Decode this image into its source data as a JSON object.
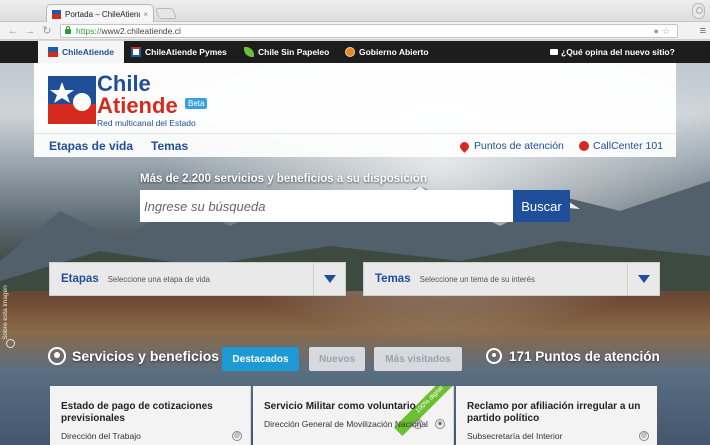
{
  "browser": {
    "tab_title": "Portada – ChileAtiende",
    "tab_close": "×",
    "url_scheme": "https://",
    "url_rest": "www2.chileatiende.cl"
  },
  "topnav": {
    "items": [
      {
        "label": "ChileAtiende",
        "icon": "chileatiende-icon"
      },
      {
        "label": "ChileAtiende Pymes",
        "icon": "pymes-icon"
      },
      {
        "label": "Chile Sin Papeleo",
        "icon": "leaf-icon"
      },
      {
        "label": "Gobierno Abierto",
        "icon": "globe-icon"
      }
    ],
    "feedback": "¿Qué opina del nuevo sitio?"
  },
  "logo": {
    "line1": "Chile",
    "line2": "Atiende",
    "badge": "Beta",
    "subtitle": "Red multicanal del Estado"
  },
  "subnav": {
    "etapas": "Etapas de vida",
    "temas": "Temas",
    "puntos": "Puntos de atención",
    "callcenter": "CallCenter 101"
  },
  "search": {
    "title": "Más de 2.200 servicios y beneficios a su disposición",
    "placeholder": "Ingrese su búsqueda",
    "button": "Buscar"
  },
  "selectors": {
    "etapas_label": "Etapas",
    "etapas_placeholder": "Seleccione una etapa de vida",
    "temas_label": "Temas",
    "temas_placeholder": "Seleccione un tema de su interés"
  },
  "side_credit": "Sobre esta imagen",
  "services": {
    "title": "Servicios y beneficios",
    "tabs": [
      "Destacados",
      "Nuevos",
      "Más visitados"
    ],
    "puntos": "171 Puntos de atención"
  },
  "cards": [
    {
      "title": "Estado de pago de cotizaciones previsionales",
      "org": "Dirección del Trabajo"
    },
    {
      "title": "Servicio Militar como voluntario",
      "org": "Dirección General de Movilización Nacional",
      "ribbon": "100% digital"
    },
    {
      "title": "Reclamo por afiliación irregular a un partido político",
      "org": "Subsecretaría del Interior"
    }
  ],
  "colors": {
    "brand_blue": "#1f4f9a",
    "brand_red": "#d52b1e",
    "active_tab": "#1d9ad6",
    "ribbon_green": "#6cbf2f"
  }
}
